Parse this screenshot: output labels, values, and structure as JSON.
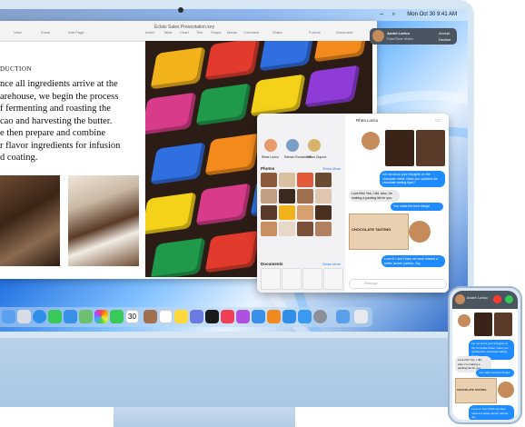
{
  "menubar": {
    "clock": "Mon Oct 30 9:41 AM"
  },
  "pages": {
    "title": "Éclats Sales Presentation.key",
    "toolbar_items": [
      "View",
      "Zoom",
      "Add Page",
      "Insert",
      "Table",
      "Chart",
      "Text",
      "Shape",
      "Media",
      "Comment",
      "Share",
      "Format",
      "Document"
    ],
    "doc_heading": "DUCTION",
    "doc_lines": [
      "nce all ingredients arrive at the",
      "arehouse, we begin the process",
      "f fermenting and roasting the",
      "cao and harvesting the butter.",
      "e then prepare and combine",
      "r flavor ingredients for infusion",
      "d coating."
    ]
  },
  "facetime": {
    "name": "André Lorico",
    "sub": "FaceTime Video",
    "accept": "Accept",
    "decline": "Decline"
  },
  "messages": {
    "contacts": [
      "Rhea Lorico",
      "Ramon Rumamitch",
      "Elton Dupont"
    ],
    "photos_label": "Photos",
    "documents_label": "Documents",
    "see_more": "Show More",
    "chat_to": "Rhea Lorico",
    "bubbles": [
      "Let me know your thoughts on the chocolate sheet. Have you updated the chocolate tasting flyer?",
      "Love this! Yes, I did. Also, I'm making a packing list for you.",
      "You make the best things!",
      "CHOCOLATE TASTING",
      "Love it! I don't think we have missed a better launch partner, Joy."
    ],
    "input_placeholder": "iMessage"
  },
  "iphone": {
    "contact": "André Lorico"
  },
  "dock": {
    "calendar_day": "30"
  },
  "colors": {
    "accent": "#1e8bff",
    "imac": "#b9d2ea"
  }
}
